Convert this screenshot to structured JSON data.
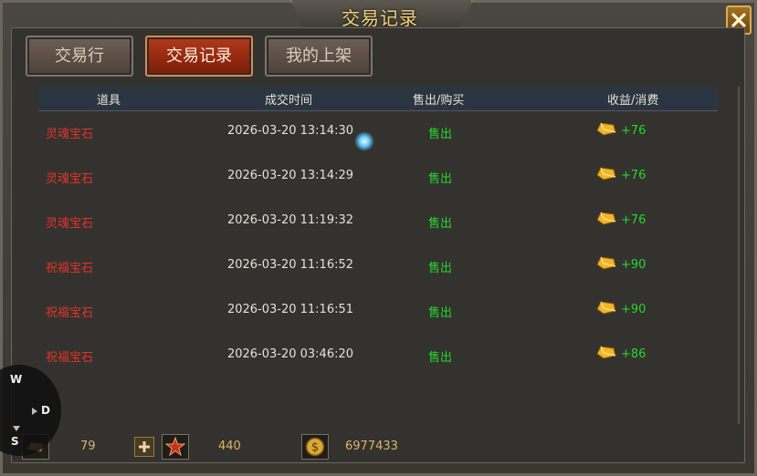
{
  "window": {
    "title": "交易记录",
    "tabs": [
      {
        "label": "交易行",
        "active": false
      },
      {
        "label": "交易记录",
        "active": true
      },
      {
        "label": "我的上架",
        "active": false
      }
    ]
  },
  "table": {
    "headers": [
      "道具",
      "成交时间",
      "售出/购买",
      "收益/消费"
    ],
    "rows": [
      {
        "item": "灵魂宝石",
        "time": "2026-03-20 13:14:30",
        "type": "售出",
        "profit": "+76"
      },
      {
        "item": "灵魂宝石",
        "time": "2026-03-20 13:14:29",
        "type": "售出",
        "profit": "+76"
      },
      {
        "item": "灵魂宝石",
        "time": "2026-03-20 11:19:32",
        "type": "售出",
        "profit": "+76"
      },
      {
        "item": "祝福宝石",
        "time": "2026-03-20 11:16:52",
        "type": "售出",
        "profit": "+90"
      },
      {
        "item": "祝福宝石",
        "time": "2026-03-20 11:16:51",
        "type": "售出",
        "profit": "+90"
      },
      {
        "item": "祝福宝石",
        "time": "2026-03-20 03:46:20",
        "type": "售出",
        "profit": "+86"
      }
    ]
  },
  "footer": {
    "currency_a": "79",
    "currency_b": "440",
    "currency_c": "6977433"
  },
  "compass": {
    "w": "W",
    "d": "D",
    "s": "S"
  },
  "colors": {
    "title": "#f2d27a",
    "item_text": "#e4322b",
    "sold_text": "#23d82d",
    "active_tab": "#b3391b"
  }
}
